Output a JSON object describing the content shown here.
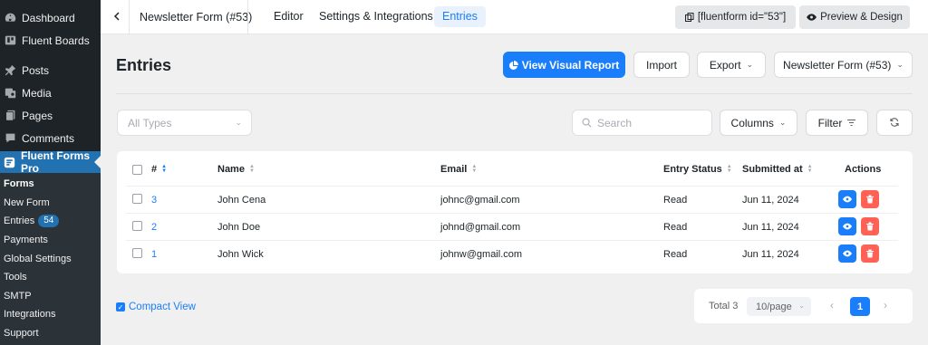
{
  "sidebar": {
    "top_items": [
      {
        "label": "Dashboard",
        "icon": "dashboard-icon"
      },
      {
        "label": "Fluent Boards",
        "icon": "boards-icon"
      }
    ],
    "mid_items": [
      {
        "label": "Posts",
        "icon": "pin-icon"
      },
      {
        "label": "Media",
        "icon": "media-icon"
      },
      {
        "label": "Pages",
        "icon": "pages-icon"
      },
      {
        "label": "Comments",
        "icon": "comment-icon"
      }
    ],
    "active_item": {
      "label": "Fluent Forms Pro",
      "icon": "fluent-forms-icon"
    },
    "submenu": [
      {
        "label": "Forms",
        "bold": true
      },
      {
        "label": "New Form"
      },
      {
        "label": "Entries",
        "badge": "54"
      },
      {
        "label": "Payments"
      },
      {
        "label": "Global Settings"
      },
      {
        "label": "Tools"
      },
      {
        "label": "SMTP"
      },
      {
        "label": "Integrations"
      },
      {
        "label": "Support"
      }
    ]
  },
  "topbar": {
    "form_title": "Newsletter Form (#53)",
    "tabs": [
      "Editor",
      "Settings & Integrations",
      "Entries"
    ],
    "active_tab": "Entries",
    "shortcode": "[fluentform id=\"53\"]",
    "preview_label": "Preview & Design"
  },
  "header": {
    "title": "Entries",
    "visual_report": "View Visual Report",
    "import": "Import",
    "export": "Export",
    "form_select": "Newsletter Form (#53)"
  },
  "filters": {
    "types_placeholder": "All Types",
    "search_placeholder": "Search",
    "columns": "Columns",
    "filter": "Filter"
  },
  "table": {
    "columns": {
      "id": "#",
      "name": "Name",
      "email": "Email",
      "status": "Entry Status",
      "submitted": "Submitted at",
      "actions": "Actions"
    },
    "rows": [
      {
        "id": "3",
        "name": "John Cena",
        "email": "johnc@gmail.com",
        "status": "Read",
        "submitted": "Jun 11, 2024"
      },
      {
        "id": "2",
        "name": "John Doe",
        "email": "johnd@gmail.com",
        "status": "Read",
        "submitted": "Jun 11, 2024"
      },
      {
        "id": "1",
        "name": "John Wick",
        "email": "johnw@gmail.com",
        "status": "Read",
        "submitted": "Jun 11, 2024"
      }
    ]
  },
  "footer": {
    "compact_view": "Compact View",
    "total": "Total 3",
    "per_page": "10/page",
    "current_page": "1"
  },
  "colors": {
    "accent": "#1a7efb",
    "danger": "#ff6154",
    "sidebar": "#1d2327",
    "active": "#2271b1"
  }
}
